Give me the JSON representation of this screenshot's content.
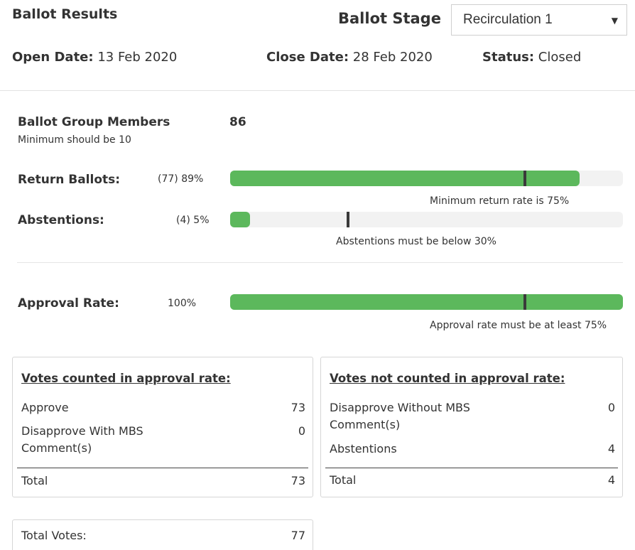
{
  "header": {
    "title": "Ballot Results",
    "stage_label": "Ballot Stage",
    "stage_select": {
      "selected": "Recirculation 1"
    },
    "open_date_label": "Open Date:",
    "open_date": "13 Feb 2020",
    "close_date_label": "Close Date:",
    "close_date": "28 Feb 2020",
    "status_label": "Status:",
    "status": "Closed"
  },
  "group": {
    "label": "Ballot Group Members",
    "count": "86",
    "minimum_note": "Minimum should be 10"
  },
  "return_ballots": {
    "label": "Return Ballots:",
    "value_text": "(77) 89%",
    "percent": 89,
    "threshold": 75,
    "hint": "Minimum return rate is 75%"
  },
  "abstentions": {
    "label": "Abstentions:",
    "value_text": "(4) 5%",
    "percent": 5,
    "threshold": 30,
    "hint": "Abstentions must be below 30%"
  },
  "approval": {
    "label": "Approval Rate:",
    "value_text": "100%",
    "percent": 100,
    "threshold": 75,
    "hint": "Approval rate must be at least 75%"
  },
  "counted": {
    "title": "Votes counted in approval rate:",
    "approve_label": "Approve",
    "approve_value": "73",
    "disapprove_label": "Disapprove With MBS Comment(s)",
    "disapprove_value": "0",
    "total_label": "Total",
    "total_value": "73"
  },
  "not_counted": {
    "title": "Votes not counted in approval rate:",
    "disapprove_label": "Disapprove Without MBS Comment(s)",
    "disapprove_value": "0",
    "abstentions_label": "Abstentions",
    "abstentions_value": "4",
    "total_label": "Total",
    "total_value": "4"
  },
  "total_votes": {
    "label": "Total Votes:",
    "value": "77"
  },
  "colors": {
    "bar_fill": "#5cb85c",
    "bar_track": "#f2f2f2",
    "marker": "#3a3a3a"
  }
}
